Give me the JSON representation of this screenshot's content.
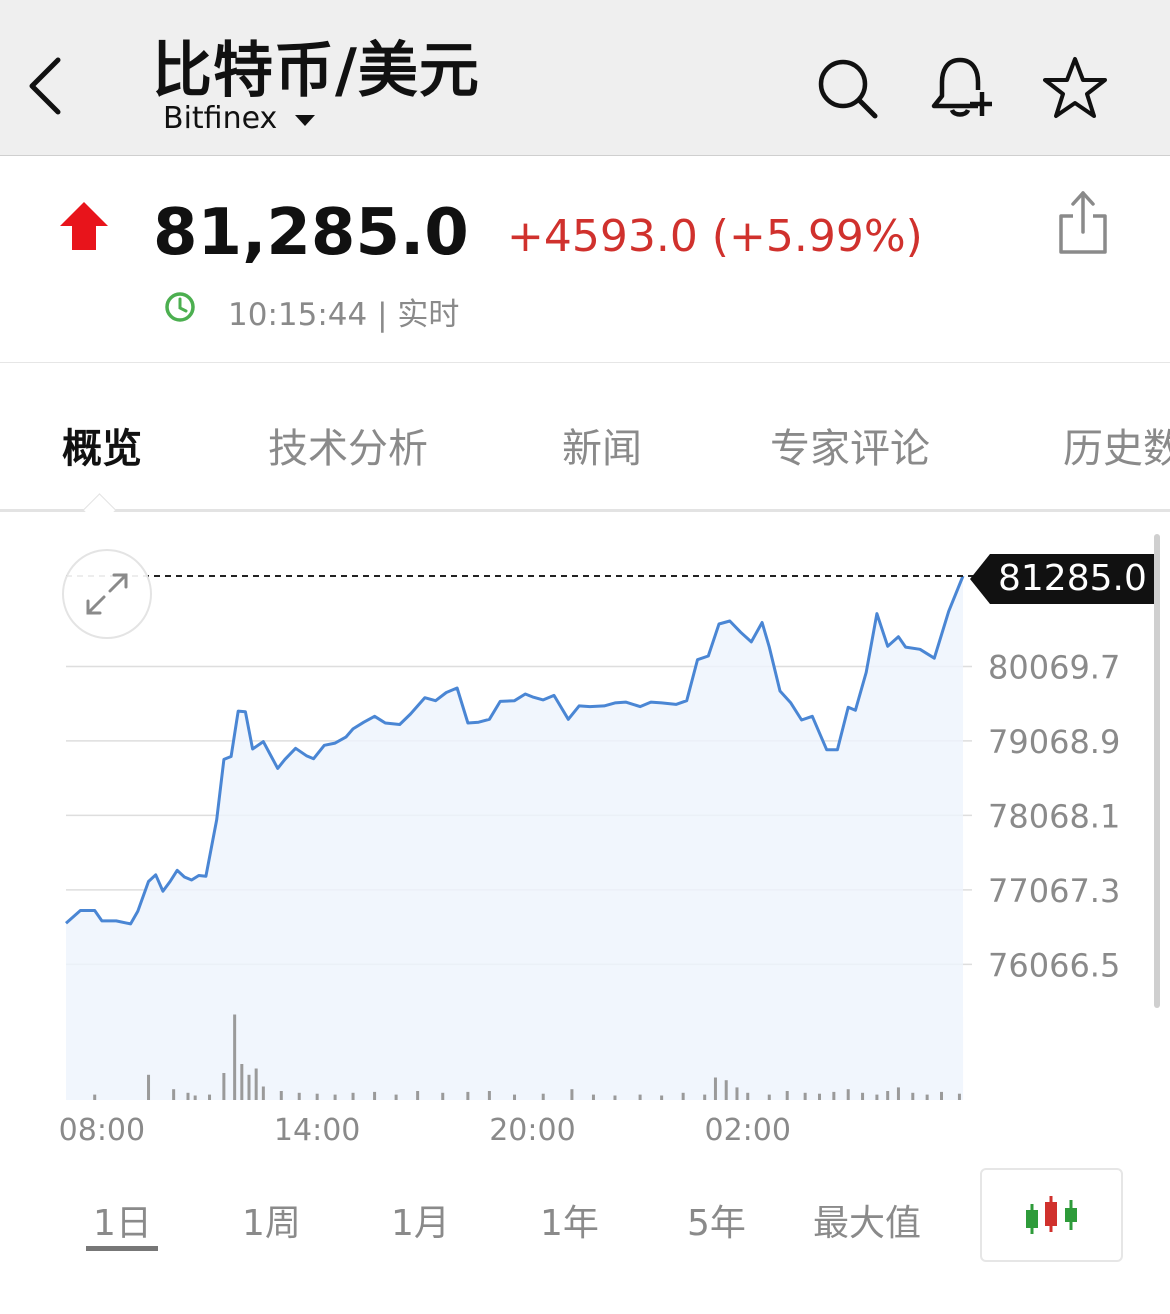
{
  "header": {
    "title": "比特币/美元",
    "exchange": "Bitfinex",
    "icons": [
      "back-icon",
      "search-icon",
      "bell-plus-icon",
      "star-icon"
    ]
  },
  "quote": {
    "price": "81,285.0",
    "change": "+4593.0 (+5.99%)",
    "time": "10:15:44 | 实时",
    "direction": "up",
    "colors": {
      "up": "#e8141b",
      "change_text": "#d0312d",
      "clock": "#4caf50"
    }
  },
  "tabs": [
    {
      "label": "概览",
      "active": true
    },
    {
      "label": "技术分析",
      "active": false
    },
    {
      "label": "新闻",
      "active": false
    },
    {
      "label": "专家评论",
      "active": false
    },
    {
      "label": "历史数",
      "active": false
    }
  ],
  "chart_data": {
    "type": "line",
    "current_price_label": "81285.0",
    "y_tick_labels": [
      "80069.7",
      "79068.9",
      "78068.1",
      "77067.3",
      "76066.5"
    ],
    "y_ticks": [
      80069.7,
      79068.9,
      78068.1,
      77067.3,
      76066.5
    ],
    "x_tick_labels": [
      "08:00",
      "14:00",
      "20:00",
      "02:00"
    ],
    "x_ticks": [
      1,
      7,
      13,
      19
    ],
    "ylim": [
      75050,
      81500
    ],
    "xlim": [
      0,
      25.25
    ],
    "line_color": "#4a86d4",
    "grid": true,
    "series": [
      {
        "x": [
          0,
          0.4,
          0.8,
          1.0,
          1.4,
          1.8,
          2.0,
          2.3,
          2.5,
          2.7,
          2.9,
          3.1,
          3.3,
          3.5,
          3.7,
          3.9,
          4.2,
          4.4,
          4.6,
          4.8,
          5.0,
          5.2,
          5.5,
          5.7,
          5.9,
          6.1,
          6.4,
          6.7,
          6.9,
          7.2,
          7.5,
          7.8,
          8.0,
          8.3,
          8.6,
          8.9,
          9.3,
          9.6,
          10.0,
          10.3,
          10.6,
          10.9,
          11.2,
          11.5,
          11.8,
          12.1,
          12.5,
          12.8,
          13.0,
          13.3,
          13.6,
          14.0,
          14.3,
          14.6,
          15.0,
          15.3,
          15.6,
          16.0,
          16.3,
          16.6,
          17.0,
          17.3,
          17.6,
          17.9,
          18.2,
          18.5,
          18.8,
          19.1,
          19.4,
          19.6,
          19.9,
          20.2,
          20.5,
          20.8,
          21.2,
          21.5,
          21.8,
          22.0,
          22.3,
          22.6,
          22.9,
          23.2,
          23.4,
          23.8,
          24.2,
          24.6,
          25.0
        ],
        "y": [
          76620,
          76790,
          76790,
          76650,
          76650,
          76610,
          76780,
          77180,
          77270,
          77050,
          77180,
          77330,
          77240,
          77200,
          77260,
          77250,
          78010,
          78820,
          78860,
          79470,
          79460,
          78960,
          79060,
          78880,
          78700,
          78820,
          78970,
          78870,
          78830,
          79010,
          79040,
          79120,
          79230,
          79320,
          79400,
          79310,
          79290,
          79430,
          79650,
          79610,
          79720,
          79780,
          79310,
          79320,
          79360,
          79600,
          79610,
          79700,
          79660,
          79620,
          79680,
          79360,
          79540,
          79530,
          79540,
          79580,
          79590,
          79530,
          79590,
          79580,
          79560,
          79610,
          80160,
          80210,
          80640,
          80680,
          80530,
          80400,
          80660,
          80330,
          79740,
          79580,
          79350,
          79400,
          78950,
          78950,
          79520,
          79480,
          79990,
          80780,
          80340,
          80470,
          80330,
          80300,
          80180,
          80810,
          81285
        ]
      }
    ],
    "volume": {
      "x": [
        0.8,
        2.3,
        3.0,
        3.4,
        3.6,
        4.0,
        4.4,
        4.7,
        4.9,
        5.1,
        5.3,
        5.5,
        6.0,
        6.5,
        7.0,
        7.5,
        8.0,
        8.6,
        9.2,
        9.8,
        10.5,
        11.2,
        11.8,
        12.5,
        13.3,
        14.1,
        14.7,
        15.3,
        16.0,
        16.6,
        17.2,
        17.8,
        18.1,
        18.4,
        18.7,
        19.0,
        19.6,
        20.1,
        20.6,
        21.0,
        21.4,
        21.8,
        22.2,
        22.6,
        22.9,
        23.2,
        23.6,
        24.0,
        24.4,
        24.9
      ],
      "y": [
        6,
        28,
        12,
        8,
        5,
        6,
        30,
        95,
        40,
        28,
        35,
        15,
        10,
        8,
        7,
        6,
        8,
        9,
        6,
        10,
        8,
        9,
        10,
        6,
        7,
        12,
        6,
        5,
        6,
        5,
        8,
        6,
        25,
        22,
        14,
        8,
        6,
        10,
        8,
        7,
        9,
        12,
        8,
        6,
        10,
        14,
        8,
        6,
        9,
        7
      ]
    }
  },
  "ranges": [
    {
      "label": "1日",
      "active": true
    },
    {
      "label": "1周",
      "active": false
    },
    {
      "label": "1月",
      "active": false
    },
    {
      "label": "1年",
      "active": false
    },
    {
      "label": "5年",
      "active": false
    },
    {
      "label": "最大值",
      "active": false
    }
  ],
  "chart_type_button_icon": "candlestick-icon"
}
